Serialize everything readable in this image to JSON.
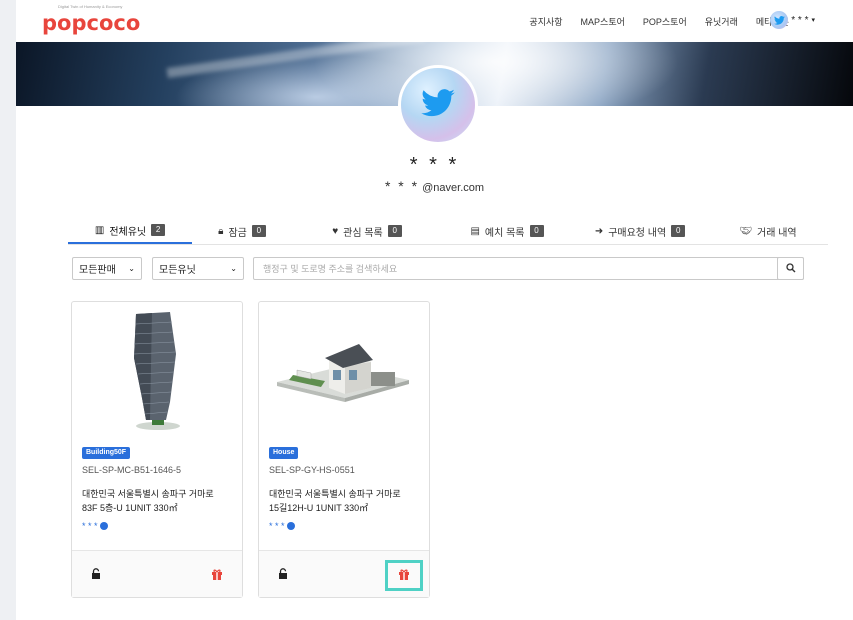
{
  "header": {
    "logo_text": "popcoco",
    "logo_tagline": "Digital Twin of Humanity & Economy",
    "nav": [
      "공지사항",
      "MAP스토어",
      "POP스토어",
      "유닛거래",
      "메타팝콘"
    ],
    "user_name": "* * *",
    "user_icon": "twitter-bird-icon"
  },
  "profile": {
    "name": "* * *",
    "email_masked": "* * *",
    "email_domain": "@naver.com",
    "avatar_icon": "twitter-bird-icon"
  },
  "tabs": [
    {
      "icon": "building-icon",
      "label": "전체유닛",
      "count": "2"
    },
    {
      "icon": "lock-icon",
      "label": "잠금",
      "count": "0"
    },
    {
      "icon": "heart-icon",
      "label": "관심 목록",
      "count": "0"
    },
    {
      "icon": "deposit-icon",
      "label": "예치 목록",
      "count": "0"
    },
    {
      "icon": "purchase-request-icon",
      "label": "구매요청 내역",
      "count": "0"
    },
    {
      "icon": "handshake-icon",
      "label": "거래 내역"
    }
  ],
  "filters": {
    "sale_select": "모든판매",
    "unit_select": "모든유닛",
    "search_placeholder": "행정구 및 도로명 주소를 검색하세요"
  },
  "units": [
    {
      "badge": "Building50F",
      "code": "SEL-SP-MC-B51-1646-5",
      "address_line1": "대한민국 서울특별시 송파구 거마로",
      "address_line2": "83F 5층-U 1UNIT 330㎡",
      "owner": "* * *"
    },
    {
      "badge": "House",
      "code": "SEL-SP-GY-HS-0551",
      "address_line1": "대한민국 서울특별시 송파구 거마로",
      "address_line2": "15길12H-U 1UNIT 330㎡",
      "owner": "* * *"
    }
  ],
  "colors": {
    "brand": "#e8453c",
    "accent": "#2a6fdb",
    "gift": "#e8453c",
    "highlight": "#4fd1c5"
  }
}
